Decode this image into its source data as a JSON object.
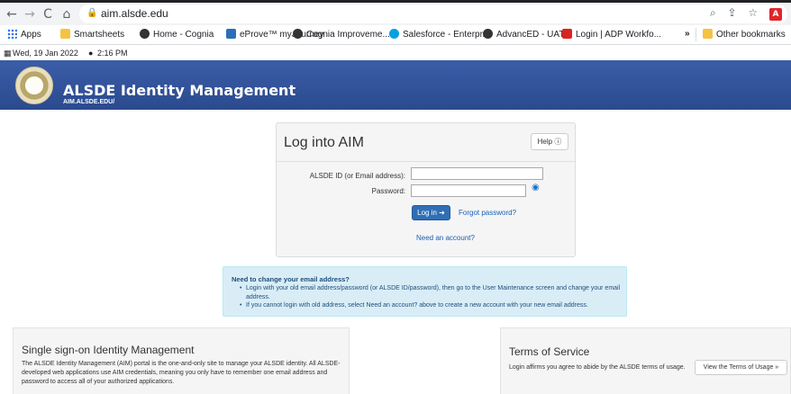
{
  "browser": {
    "url": "aim.alsde.edu",
    "nav": {
      "back": "←",
      "forward": "→",
      "reload": "C",
      "home": "⌂"
    },
    "omnibox_icons": {
      "zoom": "⌕",
      "share": "⇪",
      "star": "☆",
      "pdf": "A"
    },
    "bookmarks": [
      {
        "label": "Apps",
        "icon": "apps-icon"
      },
      {
        "label": "Smartsheets",
        "icon": "folder-icon"
      },
      {
        "label": "Home - Cognia",
        "icon": "cognia-icon"
      },
      {
        "label": "eProve™ myJourney",
        "icon": "my-icon"
      },
      {
        "label": "Cognia Improveme...",
        "icon": "cognia-icon"
      },
      {
        "label": "Salesforce - Enterpr...",
        "icon": "salesforce-icon"
      },
      {
        "label": "AdvancED - UAT",
        "icon": "advanced-icon"
      },
      {
        "label": "Login | ADP Workfo...",
        "icon": "adp-icon"
      }
    ],
    "more_bookmarks": "»",
    "other_bookmarks": "Other bookmarks"
  },
  "datebar": {
    "date": "Wed, 19 Jan 2022",
    "time": "2:16 PM"
  },
  "header": {
    "title": "ALSDE Identity Management",
    "subtitle": "AIM.ALSDE.EDU/"
  },
  "login": {
    "title": "Log into AIM",
    "help_label": "Help ⓘ",
    "id_label": "ALSDE ID (or Email address):",
    "id_value": "",
    "password_label": "Password:",
    "password_value": "",
    "login_button": "Log in ➜",
    "forgot_link": "Forgot password?",
    "need_account_link": "Need an account?"
  },
  "info": {
    "heading": "Need to change your email address?",
    "items": [
      "Login with your old email address/password (or ALSDE ID/password), then go to the User Maintenance screen and change your email address.",
      "If you cannot login with old address, select Need an account? above to create a new account with your new email address."
    ]
  },
  "sso": {
    "title": "Single sign-on Identity Management",
    "text": "The ALSDE Identity Management (AIM) portal is the one-and-only site to manage your ALSDE identity. All ALSDE-developed web applications use AIM credentials, meaning you only have to remember one email address and password to access all of your authorized applications."
  },
  "tos": {
    "title": "Terms of Service",
    "text": "Login affirms you agree to abide by the ALSDE terms of usage.",
    "button": "View the Terms of Usage »"
  },
  "colors": {
    "banner": "#2b4a8e",
    "primary_button": "#2f6fb7",
    "info_bg": "#d9edf7",
    "link": "#1a5fb4"
  }
}
